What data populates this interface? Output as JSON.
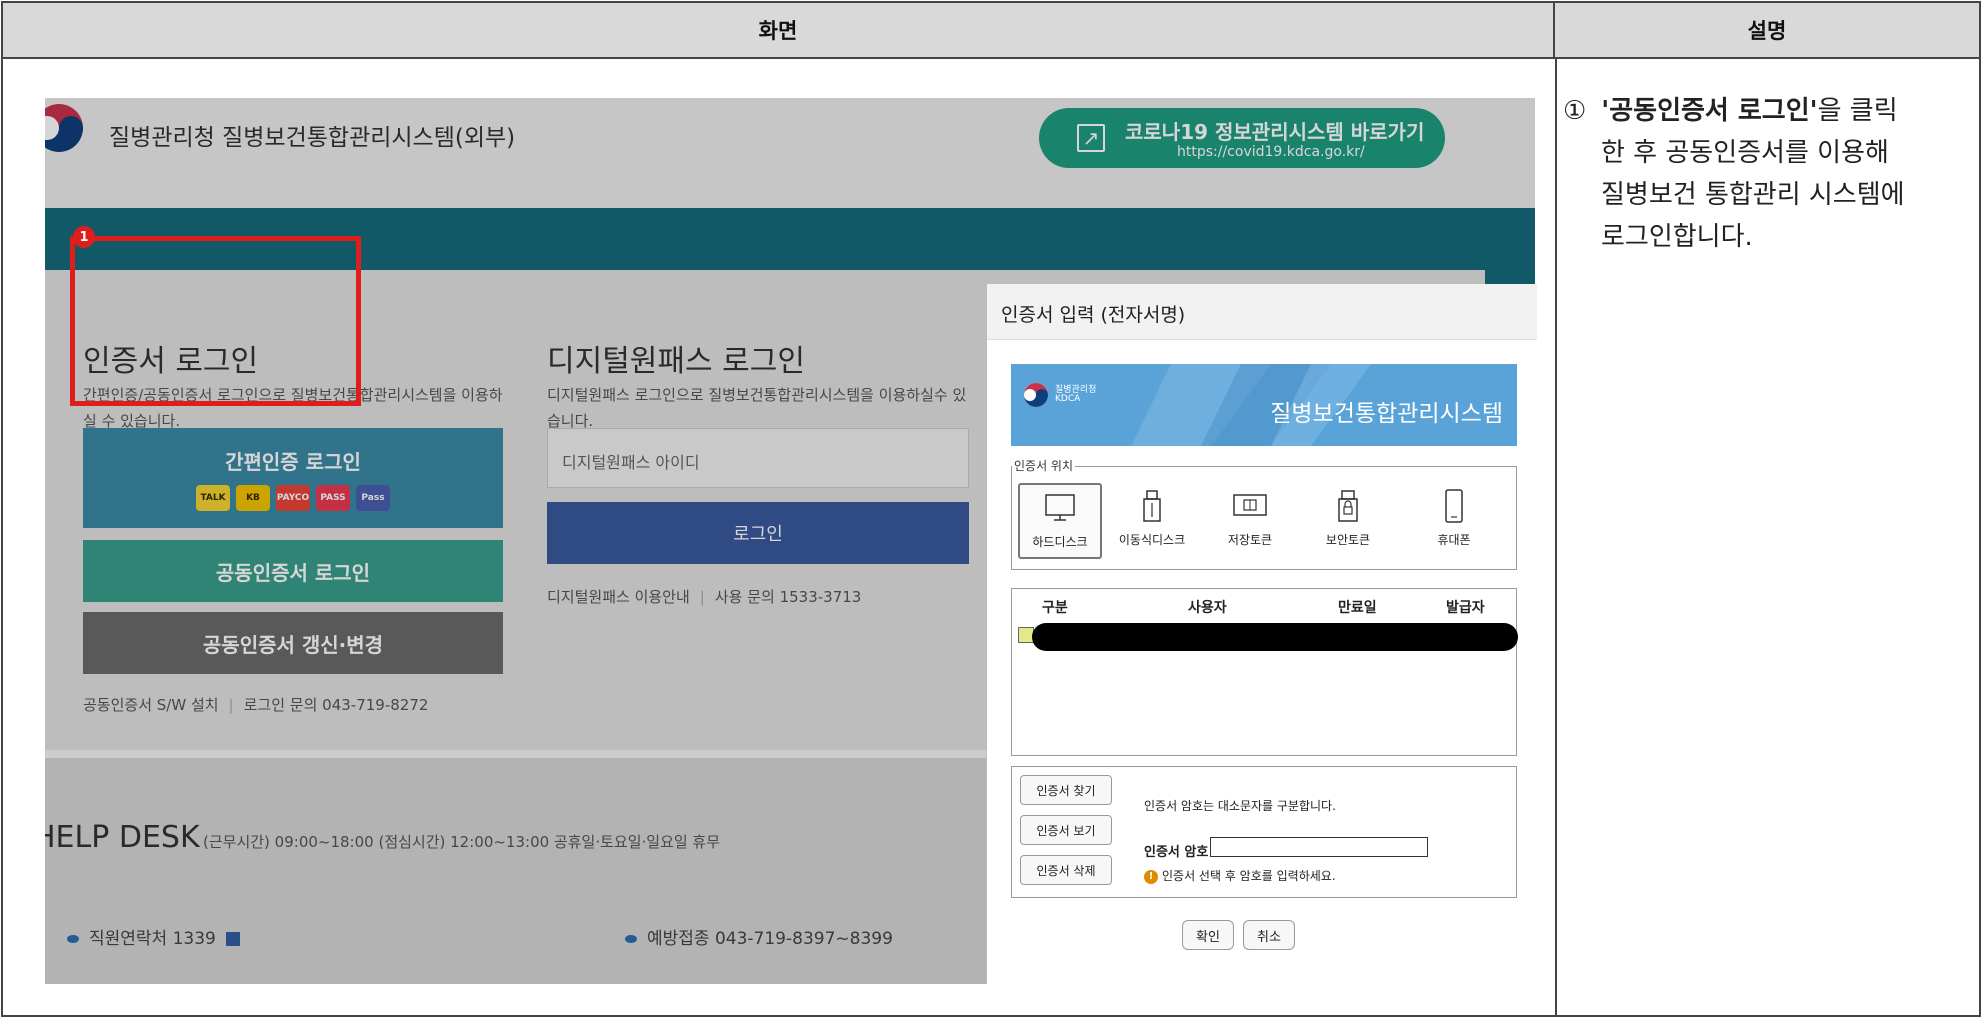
{
  "table": {
    "header_screen": "화면",
    "header_description": "설명"
  },
  "description": {
    "number": "①",
    "highlight": "'공동인증서 로그인'",
    "line1_rest": "을 클릭",
    "line2": "한 후 공동인증서를 이용해",
    "line3": "질병보건 통합관리 시스템에",
    "line4": "로그인합니다."
  },
  "site": {
    "title": "질병관리청 질병보건통합관리시스템(외부)",
    "covid_button": "코로나19 정보관리시스템 바로가기",
    "covid_url": "https://covid19.kdca.go.kr/",
    "marker_number": "1"
  },
  "cert_login": {
    "title": "인증서 로그인",
    "desc": "간편인증/공동인증서 로그인으로 질병보건통합관리시스템을 이용하실 수 있습니다.",
    "simple_button": "간편인증 로그인",
    "simple_badges": [
      "TALK",
      "KB",
      "PAYCO",
      "PASS",
      "Pass"
    ],
    "public_button": "공동인증서 로그인",
    "renew_button": "공동인증서 갱신·변경",
    "sw_install": "공동인증서 S/W 설치",
    "login_inquiry": "로그인 문의 043-719-8272"
  },
  "digital_login": {
    "title": "디지털원패스 로그인",
    "desc": "디지털원패스 로그인으로 질병보건통합관리시스템을 이용하실수 있습니다.",
    "id_placeholder": "디지털원패스 아이디",
    "login_button": "로그인",
    "guide": "디지털원패스 이용안내",
    "usage_inquiry": "사용 문의 1533-3713"
  },
  "help": {
    "title": "HELP DESK",
    "hours": "(근무시간) 09:00~18:00 (점심시간) 12:00~13:00 공휴일·토요일·일요일 휴무",
    "staff_contact": "직원연락처  1339",
    "vaccination": "예방접종  043-719-8397~8399"
  },
  "dialog": {
    "title": "인증서 입력 (전자서명)",
    "banner_org": "질병관리청",
    "banner_kdca": "KDCA",
    "banner_title": "질병보건통합관리시스템",
    "location_legend": "인증서 위치",
    "locations": [
      "하드디스크",
      "이동식디스크",
      "저장토큰",
      "보안토큰",
      "휴대폰"
    ],
    "columns": [
      "구분",
      "사용자",
      "만료일",
      "발급자"
    ],
    "btn_find": "인증서 찾기",
    "btn_view": "인증서 보기",
    "btn_delete": "인증서 삭제",
    "note_case": "인증서 암호는 대소문자를 구분합니다.",
    "password_label": "인증서 암호",
    "warning": "인증서 선택 후 암호를 입력하세요.",
    "confirm": "확인",
    "cancel": "취소"
  }
}
